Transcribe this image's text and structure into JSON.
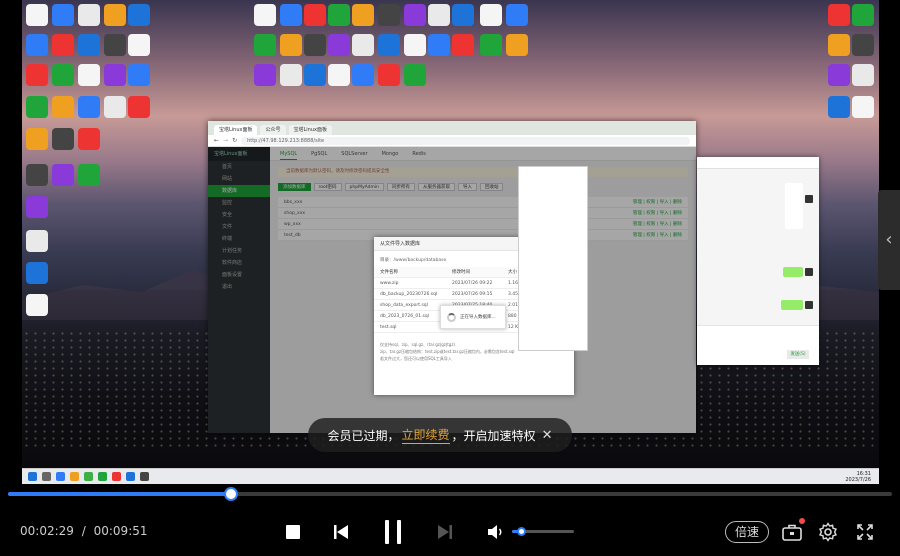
{
  "video": {
    "browser_tabs": [
      "宝塔Linux面板",
      "公众号",
      "宝塔Linux面板"
    ],
    "browser_url": "http://47.98.129.213:8888/site",
    "sidebar_title": "宝塔Linux面板",
    "sidebar_items": [
      "首页",
      "网站",
      "数据库",
      "监控",
      "安全",
      "文件",
      "终端",
      "计划任务",
      "软件商店",
      "面板设置",
      "退出"
    ],
    "sidebar_active_index": 2,
    "content_tabs": [
      "MySQL",
      "PgSQL",
      "SQLServer",
      "Mongo",
      "Redis"
    ],
    "notice": "当前数据库为默认密码，请及时修改密码提高安全性",
    "toolbar": [
      "添加数据库",
      "root密码",
      "phpMyAdmin",
      "同步所有",
      "从服务器获取",
      "导入",
      "回收站"
    ],
    "table_rows": [
      "bbs_xxx",
      "shop_xxx",
      "wp_xxx",
      "test_db"
    ],
    "row_action": "管理 | 权限 | 导入 | 删除",
    "modal": {
      "title": "从文件导入数据库",
      "path": "目录：/www/backup/database",
      "columns": [
        "文件名称",
        "修改时间",
        "大小",
        "操作"
      ],
      "rows": [
        {
          "name": "www.zip",
          "time": "2023/07/26 09:22",
          "size": "1.16 MB",
          "op": "导入 | 删除"
        },
        {
          "name": "db_backup_20230726.sql",
          "time": "2023/07/26 09:15",
          "size": "3.45 MB",
          "op": "导入 | 删除"
        },
        {
          "name": "shop_data_export.sql",
          "time": "2023/07/25 18:40",
          "size": "2.01 MB",
          "op": "导入 | 删除"
        },
        {
          "name": "db_2023_0726_01.sql",
          "time": "2023/07/25 17:02",
          "size": "880 KB",
          "op": "导入 | 删除"
        },
        {
          "name": "test.sql",
          "time": "2023/07/21 11:58",
          "size": "12 KB",
          "op": "导入 | 删除"
        }
      ],
      "notes": [
        "仅支持sql、zip、sql.gz、(tar.gz|gz|tgz)",
        "zip、tar.gz压缩包结构：test.zip或test.tar.gz压缩包内，必需包含test.sql",
        "若文件过大，您还可以使用SQL工具导入"
      ],
      "loading_text": "正在导入数据库..."
    },
    "chat_send": "发送(S)",
    "taskbar_time": "16:31\n2023/7/26"
  },
  "banner": {
    "text_before": "会员已过期，",
    "link": "立即续费",
    "text_after": "，开启加速特权"
  },
  "player": {
    "current_time": "00:02:29",
    "separator": "/",
    "total_time": "00:09:51",
    "progress_fraction": 0.252,
    "volume_fraction": 0.15,
    "speed_label": "倍速",
    "accent_color": "#2f7cf6"
  }
}
